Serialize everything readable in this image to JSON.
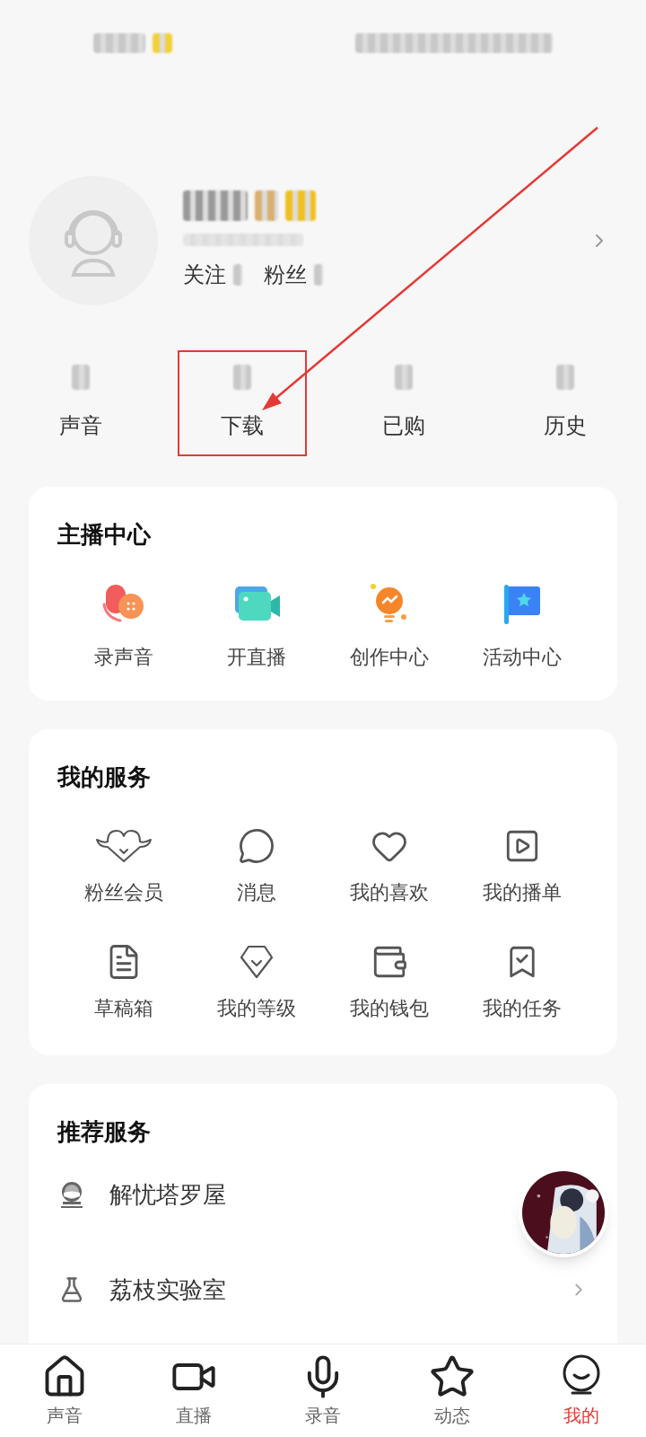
{
  "profile": {
    "follow_label": "关注",
    "fans_label": "粉丝"
  },
  "stats": [
    {
      "label": "声音",
      "highlighted": false
    },
    {
      "label": "下载",
      "highlighted": true
    },
    {
      "label": "已购",
      "highlighted": false
    },
    {
      "label": "历史",
      "highlighted": false
    }
  ],
  "host_center": {
    "title": "主播中心",
    "items": [
      {
        "kind": "record",
        "label": "录声音"
      },
      {
        "kind": "live",
        "label": "开直播"
      },
      {
        "kind": "create",
        "label": "创作中心"
      },
      {
        "kind": "event",
        "label": "活动中心"
      }
    ]
  },
  "my_services": {
    "title": "我的服务",
    "items": [
      {
        "kind": "fans",
        "label": "粉丝会员"
      },
      {
        "kind": "message",
        "label": "消息"
      },
      {
        "kind": "like",
        "label": "我的喜欢"
      },
      {
        "kind": "playlist",
        "label": "我的播单"
      },
      {
        "kind": "draft",
        "label": "草稿箱"
      },
      {
        "kind": "level",
        "label": "我的等级"
      },
      {
        "kind": "wallet",
        "label": "我的钱包"
      },
      {
        "kind": "task",
        "label": "我的任务"
      }
    ]
  },
  "recommended": {
    "title": "推荐服务",
    "items": [
      {
        "kind": "crystal",
        "label": "解忧塔罗屋",
        "chevron": false
      },
      {
        "kind": "flask",
        "label": "荔枝实验室",
        "chevron": true
      }
    ]
  },
  "tab_bar": [
    {
      "kind": "home",
      "label": "声音",
      "selected": false
    },
    {
      "kind": "video",
      "label": "直播",
      "selected": false
    },
    {
      "kind": "mic",
      "label": "录音",
      "selected": false
    },
    {
      "kind": "star",
      "label": "动态",
      "selected": false
    },
    {
      "kind": "me",
      "label": "我的",
      "selected": true
    }
  ]
}
